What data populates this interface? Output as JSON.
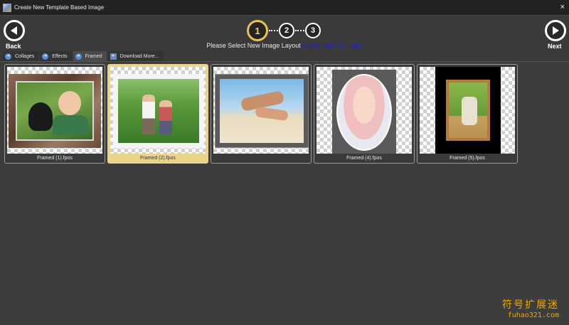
{
  "window": {
    "title": "Create New Template Based Image",
    "close_glyph": "×"
  },
  "nav": {
    "back_label": "Back",
    "next_label": "Next"
  },
  "steps": [
    "1",
    "2",
    "3"
  ],
  "instruction": {
    "text": "Please Select New Image Layout ",
    "help_link": "(Click Here For Help)"
  },
  "tabs": [
    {
      "label": "Collages",
      "icon": "arrow-circle-icon"
    },
    {
      "label": "Effects",
      "icon": "arrow-circle-icon"
    },
    {
      "label": "Framed",
      "icon": "arrow-circle-icon"
    },
    {
      "label": "Download More...",
      "icon": "download-icon"
    }
  ],
  "templates": [
    {
      "label": "Framed (1).fpos"
    },
    {
      "label": "Framed (2).fpos"
    },
    {
      "label": ""
    },
    {
      "label": "Framed (4).fpos"
    },
    {
      "label": "Framed (5).fpos"
    }
  ],
  "watermark": {
    "line1": "符号扩展迷",
    "line2": "fuhao321.com"
  },
  "colors": {
    "background": "#3a3a3a",
    "active_step": "#e8c252",
    "selected_tile": "#e9d48a",
    "help_link": "#2020c8",
    "tab_icon": "#5a8fd8"
  }
}
